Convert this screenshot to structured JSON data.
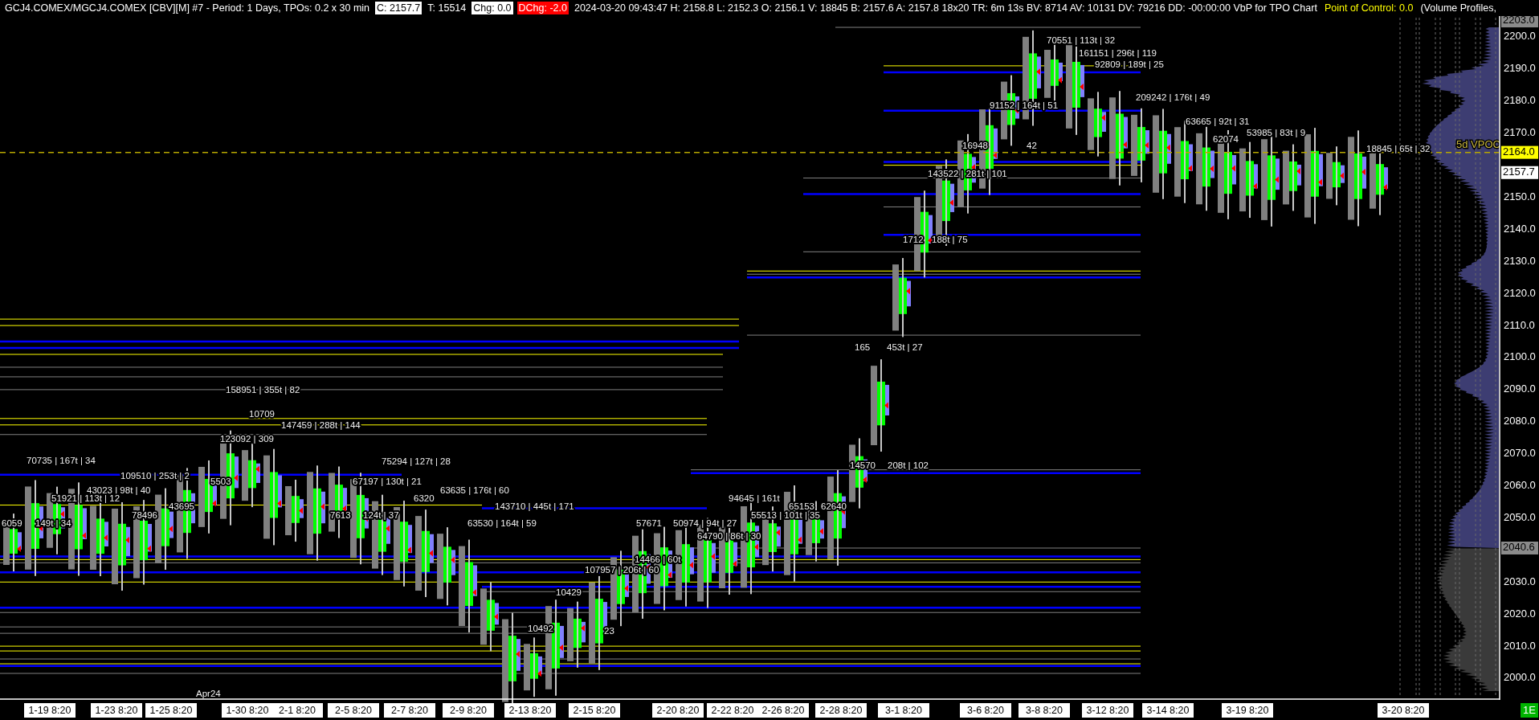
{
  "header": {
    "items": [
      {
        "text": "GCJ4.COMEX/MGCJ4.COMEX [CBV][M] #7 - Period: 1 Days, TPOs: 0.2 x 30 min",
        "kind": "plain"
      },
      {
        "text": "C: 2157.7",
        "kind": "highlight"
      },
      {
        "text": "T: 15514",
        "kind": "plain"
      },
      {
        "text": "Chg: 0.0",
        "kind": "highlight"
      },
      {
        "text": "DChg: -2.0",
        "kind": "alert"
      },
      {
        "text": "2024-03-20 09:43:47 H: 2158.8 L: 2152.3 O: 2156.1 V: 18845 B: 2157.6 A: 2157.8 18x20 TR: 6m 13s BV: 8714 AV: 10131 DV: 79216 DD: -00:00:00 VbP for TPO Chart",
        "kind": "plain"
      },
      {
        "text": "Point of Control: 0.0",
        "kind": "study"
      },
      {
        "text": "(Volume Profiles,",
        "kind": "plain"
      }
    ]
  },
  "profile_labels": [
    "70551 | 113t | 32",
    "161151 | 296t | 119",
    "92809 | 189t | 25",
    "209242 | 176t | 49",
    "91152 | 164t | 51",
    "63665 | 92t | 31",
    "53985 | 83t | 9",
    "62074",
    "16948",
    "42",
    "18845 | 65t | 32",
    "143522 | 281t | 101",
    "1712",
    "188t | 75",
    "165",
    "453t | 27",
    "158951 | 355t | 82",
    "10709",
    "147459 | 288t | 144",
    "123092 | 309",
    "70735 | 167t | 34",
    "75294 | 127t | 28",
    "14570",
    "208t | 102",
    "109510 | 253t | 2",
    "5503",
    "67197 | 130t | 21",
    "43023 | 98t | 40",
    "63635 | 176t | 60",
    "51921 | 113t | 12",
    "6320",
    "94645 | 161t",
    "43695",
    "143710 | 445t | 171",
    "65153",
    "62640",
    "78496",
    "7613",
    "124t | 37",
    "55513 | 101t | 35",
    "6059",
    "149t | 34",
    "63530 | 164t | 59",
    "57671",
    "50974 | 94t | 27",
    "64790 | 86t | 30",
    "14466 | 60t",
    "107957 | 206t | 60",
    "10429",
    "10492",
    "23"
  ],
  "vpoc_label": "5d VPOC",
  "month_label": "Apr24",
  "price_axis": {
    "labels": [
      "2200.0",
      "2190.0",
      "2180.0",
      "2170.0",
      "2150.0",
      "2140.0",
      "2130.0",
      "2120.0",
      "2110.0",
      "2100.0",
      "2090.0",
      "2080.0",
      "2070.0",
      "2060.0",
      "2050.0",
      "2030.0",
      "2020.0",
      "2010.0",
      "2000.0"
    ],
    "tags": [
      {
        "text": "2203.0",
        "kind": "high"
      },
      {
        "text": "2164.0",
        "kind": "vpoc"
      },
      {
        "text": "2157.7",
        "kind": "last"
      },
      {
        "text": "2040.6",
        "kind": "split"
      }
    ]
  },
  "date_axis": {
    "labels": [
      "1-19  8:20",
      "1-23  8:20",
      "1-25  8:20",
      "1-30  8:20",
      "2-1  8:20",
      "2-5  8:20",
      "2-7  8:20",
      "2-9  8:20",
      "2-13  8:20",
      "2-15  8:20",
      "2-20  8:20",
      "2-22  8:20",
      "2-26  8:20",
      "2-28  8:20",
      "3-1  8:20",
      "3-6  8:20",
      "3-8  8:20",
      "3-12  8:20",
      "3-14  8:20",
      "3-19  8:20",
      "3-20  8:20"
    ]
  },
  "status_badge": "1E"
}
